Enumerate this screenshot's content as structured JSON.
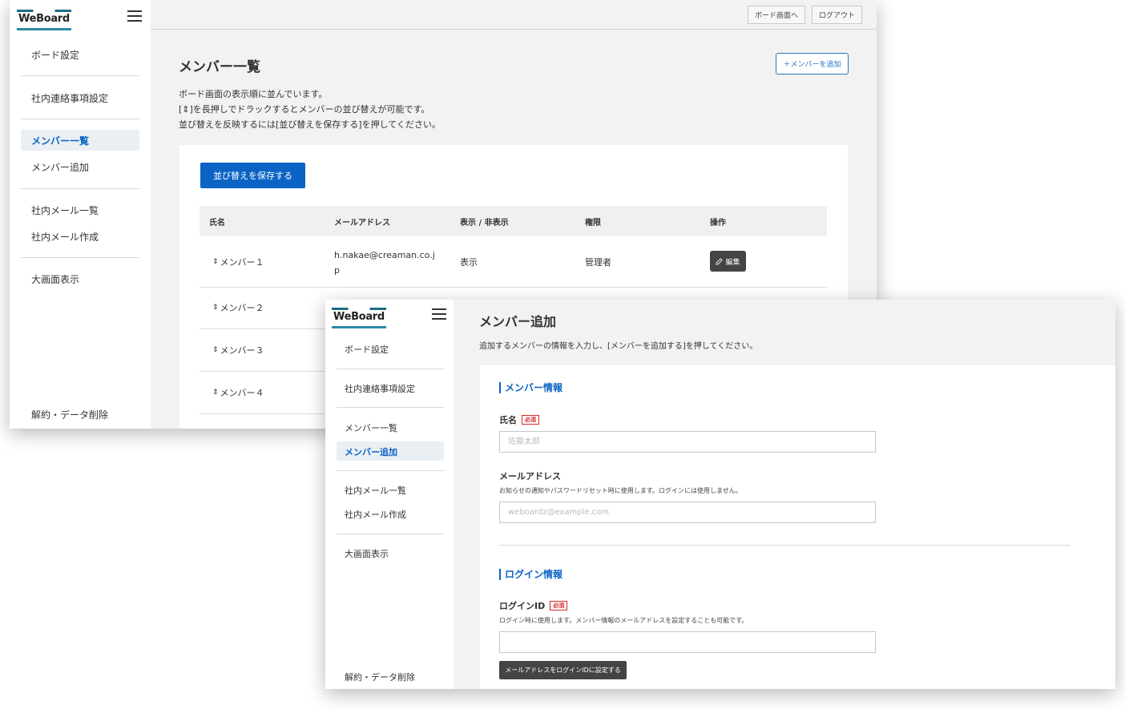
{
  "brand": {
    "logo_text": "WeBoard"
  },
  "nav": {
    "board_settings": "ボード設定",
    "notice_settings": "社内連絡事項設定",
    "member_list": "メンバー一覧",
    "member_add": "メンバー追加",
    "mail_list": "社内メール一覧",
    "mail_create": "社内メール作成",
    "large_display": "大画面表示",
    "cancel_delete": "解約・データ削除"
  },
  "topbar": {
    "board_view": "ボード画面へ",
    "logout": "ログアウト"
  },
  "member_list_page": {
    "title": "メンバー一覧",
    "add_button": "＋メンバーを追加",
    "description": [
      "ボード画面の表示順に並んでいます。",
      "[⇕]を長押しでドラックするとメンバーの並び替えが可能です。",
      "並び替えを反映するには[並び替えを保存する]を押してください。"
    ],
    "save_button": "並び替えを保存する",
    "columns": [
      "氏名",
      "メールアドレス",
      "表示 / 非表示",
      "権限",
      "操作"
    ],
    "rows": [
      {
        "name": "メンバー１",
        "email_line1": "h.nakae@creaman.co.j",
        "email_line2": "p",
        "visibility": "表示",
        "role": "管理者",
        "action": "編集"
      },
      {
        "name": "メンバー２"
      },
      {
        "name": "メンバー３"
      },
      {
        "name": "メンバー４"
      }
    ],
    "drag_icon": "⇕"
  },
  "member_add_page": {
    "title": "メンバー追加",
    "description": "追加するメンバーの情報を入力し、[メンバーを追加する]を押してください。",
    "member_info_section": "メンバー情報",
    "name_label": "氏名",
    "required_badge": "必須",
    "name_placeholder": "佐藤太郎",
    "email_label": "メールアドレス",
    "email_hint": "お知らせの通知やパスワードリセット時に使用します。ログインには使用しません。",
    "email_placeholder": "weboardz@example.com",
    "login_section": "ログイン情報",
    "login_id_label": "ログインID",
    "login_id_hint": "ログイン時に使用します。メンバー情報のメールアドレスを設定することも可能です。",
    "login_id_value": "",
    "copy_email_button": "メールアドレスをログインIDに設定する"
  },
  "colors": {
    "accent": "#0b63c5",
    "required": "#d42a2a",
    "dark_button": "#444444"
  }
}
